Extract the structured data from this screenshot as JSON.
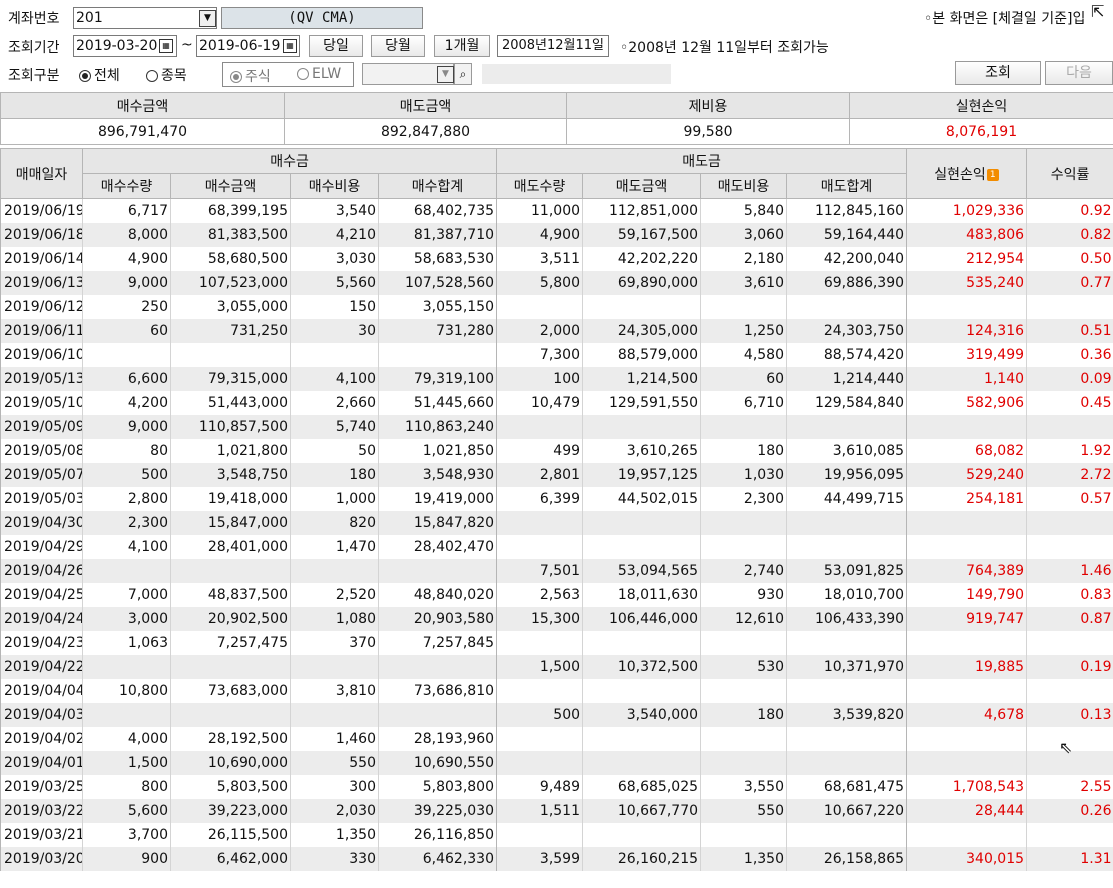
{
  "toolbar": {
    "account_label": "계좌번호",
    "account_value": "201",
    "account_name": "(QV CMA)",
    "notice": "◦본 화면은 [체결일 기준]입",
    "period_label": "조회기간",
    "date_from": "2019-03-20",
    "date_sep": "~",
    "date_to": "2019-06-19",
    "btn_today": "당일",
    "btn_month": "당월",
    "btn_1month": "1개월",
    "since_date": "2008년12월11일",
    "since_note": "◦2008년 12월 11일부터 조회가능",
    "type_label": "조회구분",
    "radio_all": "전체",
    "radio_item": "종목",
    "radio_stock": "주식",
    "radio_elw": "ELW",
    "btn_query": "조회",
    "btn_next": "다음"
  },
  "summary": {
    "headers": [
      "매수금액",
      "매도금액",
      "제비용",
      "실현손익"
    ],
    "values": [
      "896,791,470",
      "892,847,880",
      "99,580",
      "8,076,191"
    ]
  },
  "table": {
    "h_date": "매매일자",
    "h_buy": "매수금",
    "h_sell": "매도금",
    "h_pnl": "실현손익",
    "h_pnl_badge": "1",
    "h_rate": "수익률",
    "buy_cols": [
      "매수수량",
      "매수금액",
      "매수비용",
      "매수합계"
    ],
    "sell_cols": [
      "매도수량",
      "매도금액",
      "매도비용",
      "매도합계"
    ],
    "rows": [
      [
        "2019/06/19",
        "6,717",
        "68,399,195",
        "3,540",
        "68,402,735",
        "11,000",
        "112,851,000",
        "5,840",
        "112,845,160",
        "1,029,336",
        "0.92"
      ],
      [
        "2019/06/18",
        "8,000",
        "81,383,500",
        "4,210",
        "81,387,710",
        "4,900",
        "59,167,500",
        "3,060",
        "59,164,440",
        "483,806",
        "0.82"
      ],
      [
        "2019/06/14",
        "4,900",
        "58,680,500",
        "3,030",
        "58,683,530",
        "3,511",
        "42,202,220",
        "2,180",
        "42,200,040",
        "212,954",
        "0.50"
      ],
      [
        "2019/06/13",
        "9,000",
        "107,523,000",
        "5,560",
        "107,528,560",
        "5,800",
        "69,890,000",
        "3,610",
        "69,886,390",
        "535,240",
        "0.77"
      ],
      [
        "2019/06/12",
        "250",
        "3,055,000",
        "150",
        "3,055,150",
        "",
        "",
        "",
        "",
        "",
        ""
      ],
      [
        "2019/06/11",
        "60",
        "731,250",
        "30",
        "731,280",
        "2,000",
        "24,305,000",
        "1,250",
        "24,303,750",
        "124,316",
        "0.51"
      ],
      [
        "2019/06/10",
        "",
        "",
        "",
        "",
        "7,300",
        "88,579,000",
        "4,580",
        "88,574,420",
        "319,499",
        "0.36"
      ],
      [
        "2019/05/13",
        "6,600",
        "79,315,000",
        "4,100",
        "79,319,100",
        "100",
        "1,214,500",
        "60",
        "1,214,440",
        "1,140",
        "0.09"
      ],
      [
        "2019/05/10",
        "4,200",
        "51,443,000",
        "2,660",
        "51,445,660",
        "10,479",
        "129,591,550",
        "6,710",
        "129,584,840",
        "582,906",
        "0.45"
      ],
      [
        "2019/05/09",
        "9,000",
        "110,857,500",
        "5,740",
        "110,863,240",
        "",
        "",
        "",
        "",
        "",
        ""
      ],
      [
        "2019/05/08",
        "80",
        "1,021,800",
        "50",
        "1,021,850",
        "499",
        "3,610,265",
        "180",
        "3,610,085",
        "68,082",
        "1.92"
      ],
      [
        "2019/05/07",
        "500",
        "3,548,750",
        "180",
        "3,548,930",
        "2,801",
        "19,957,125",
        "1,030",
        "19,956,095",
        "529,240",
        "2.72"
      ],
      [
        "2019/05/03",
        "2,800",
        "19,418,000",
        "1,000",
        "19,419,000",
        "6,399",
        "44,502,015",
        "2,300",
        "44,499,715",
        "254,181",
        "0.57"
      ],
      [
        "2019/04/30",
        "2,300",
        "15,847,000",
        "820",
        "15,847,820",
        "",
        "",
        "",
        "",
        "",
        ""
      ],
      [
        "2019/04/29",
        "4,100",
        "28,401,000",
        "1,470",
        "28,402,470",
        "",
        "",
        "",
        "",
        "",
        ""
      ],
      [
        "2019/04/26",
        "",
        "",
        "",
        "",
        "7,501",
        "53,094,565",
        "2,740",
        "53,091,825",
        "764,389",
        "1.46"
      ],
      [
        "2019/04/25",
        "7,000",
        "48,837,500",
        "2,520",
        "48,840,020",
        "2,563",
        "18,011,630",
        "930",
        "18,010,700",
        "149,790",
        "0.83"
      ],
      [
        "2019/04/24",
        "3,000",
        "20,902,500",
        "1,080",
        "20,903,580",
        "15,300",
        "106,446,000",
        "12,610",
        "106,433,390",
        "919,747",
        "0.87"
      ],
      [
        "2019/04/23",
        "1,063",
        "7,257,475",
        "370",
        "7,257,845",
        "",
        "",
        "",
        "",
        "",
        ""
      ],
      [
        "2019/04/22",
        "",
        "",
        "",
        "",
        "1,500",
        "10,372,500",
        "530",
        "10,371,970",
        "19,885",
        "0.19"
      ],
      [
        "2019/04/04",
        "10,800",
        "73,683,000",
        "3,810",
        "73,686,810",
        "",
        "",
        "",
        "",
        "",
        ""
      ],
      [
        "2019/04/03",
        "",
        "",
        "",
        "",
        "500",
        "3,540,000",
        "180",
        "3,539,820",
        "4,678",
        "0.13"
      ],
      [
        "2019/04/02",
        "4,000",
        "28,192,500",
        "1,460",
        "28,193,960",
        "",
        "",
        "",
        "",
        "",
        ""
      ],
      [
        "2019/04/01",
        "1,500",
        "10,690,000",
        "550",
        "10,690,550",
        "",
        "",
        "",
        "",
        "",
        ""
      ],
      [
        "2019/03/25",
        "800",
        "5,803,500",
        "300",
        "5,803,800",
        "9,489",
        "68,685,025",
        "3,550",
        "68,681,475",
        "1,708,543",
        "2.55"
      ],
      [
        "2019/03/22",
        "5,600",
        "39,223,000",
        "2,030",
        "39,225,030",
        "1,511",
        "10,667,770",
        "550",
        "10,667,220",
        "28,444",
        "0.26"
      ],
      [
        "2019/03/21",
        "3,700",
        "26,115,500",
        "1,350",
        "26,116,850",
        "",
        "",
        "",
        "",
        "",
        ""
      ],
      [
        "2019/03/20",
        "900",
        "6,462,000",
        "330",
        "6,462,330",
        "3,599",
        "26,160,215",
        "1,350",
        "26,158,865",
        "340,015",
        "1.31"
      ]
    ]
  }
}
